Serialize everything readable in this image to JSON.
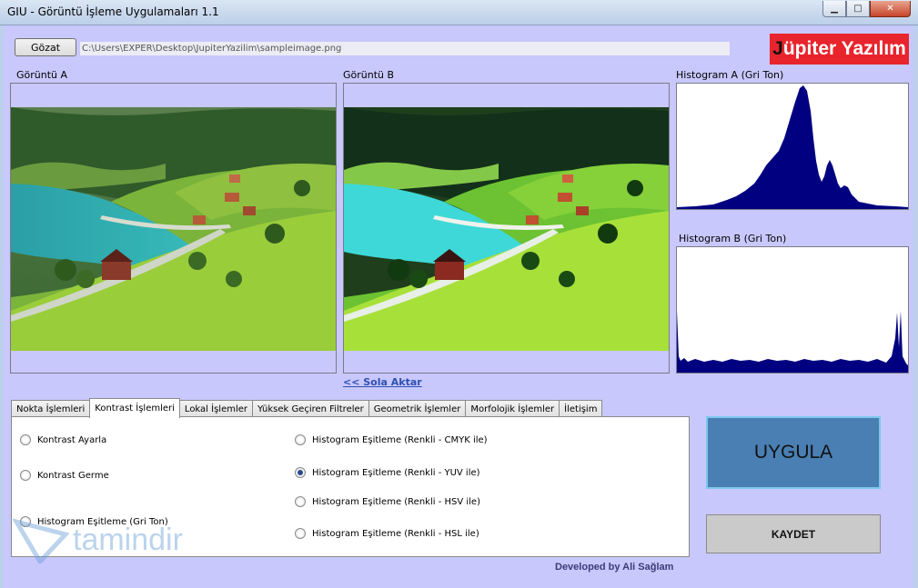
{
  "window": {
    "title": "GIU - Görüntü İşleme Uygulamaları 1.1",
    "minimize_glyph": "▁",
    "maximize_glyph": "□",
    "close_glyph": "✕"
  },
  "toolbar": {
    "browse_label": "Gözat",
    "file_path": "C:\\Users\\EXPER\\Desktop\\JupiterYazilim\\sampleimage.png"
  },
  "brand": {
    "first_letter": "J",
    "rest": "üpiter Yazılım"
  },
  "image_a": {
    "label": "Görüntü A"
  },
  "image_b": {
    "label": "Görüntü B"
  },
  "hist_a": {
    "label": "Histogram A (Gri Ton)"
  },
  "hist_b": {
    "label": "Histogram B (Gri Ton)"
  },
  "move_left_link": "<< Sola Aktar",
  "tabs": [
    {
      "label": "Nokta İşlemleri"
    },
    {
      "label": "Kontrast İşlemleri",
      "active": true
    },
    {
      "label": "Lokal İşlemler"
    },
    {
      "label": "Yüksek Geçiren Filtreler"
    },
    {
      "label": "Geometrik İşlemler"
    },
    {
      "label": "Morfolojik İşlemler"
    },
    {
      "label": "İletişim"
    }
  ],
  "options": {
    "contrast_adjust": "Kontrast Ayarla",
    "contrast_stretch": "Kontrast Germe",
    "hist_eq_gray": "Histogram Eşitleme (Gri Ton)",
    "hist_eq_cmyk": "Histogram Eşitleme (Renkli - CMYK ile)",
    "hist_eq_yuv": "Histogram Eşitleme (Renkli - YUV ile)",
    "hist_eq_hsv": "Histogram Eşitleme (Renkli - HSV ile)",
    "hist_eq_hsl": "Histogram Eşitleme (Renkli - HSL ile)",
    "selected": "hist_eq_yuv"
  },
  "actions": {
    "apply_label": "UYGULA",
    "save_label": "KAYDET"
  },
  "credit": "Developed by Ali Sağlam",
  "watermark": "tamindir",
  "colors": {
    "background": "#c8c8fc",
    "brand_red": "#e8242c",
    "histogram": "#000080",
    "apply_blue": "#4a7fb4"
  }
}
